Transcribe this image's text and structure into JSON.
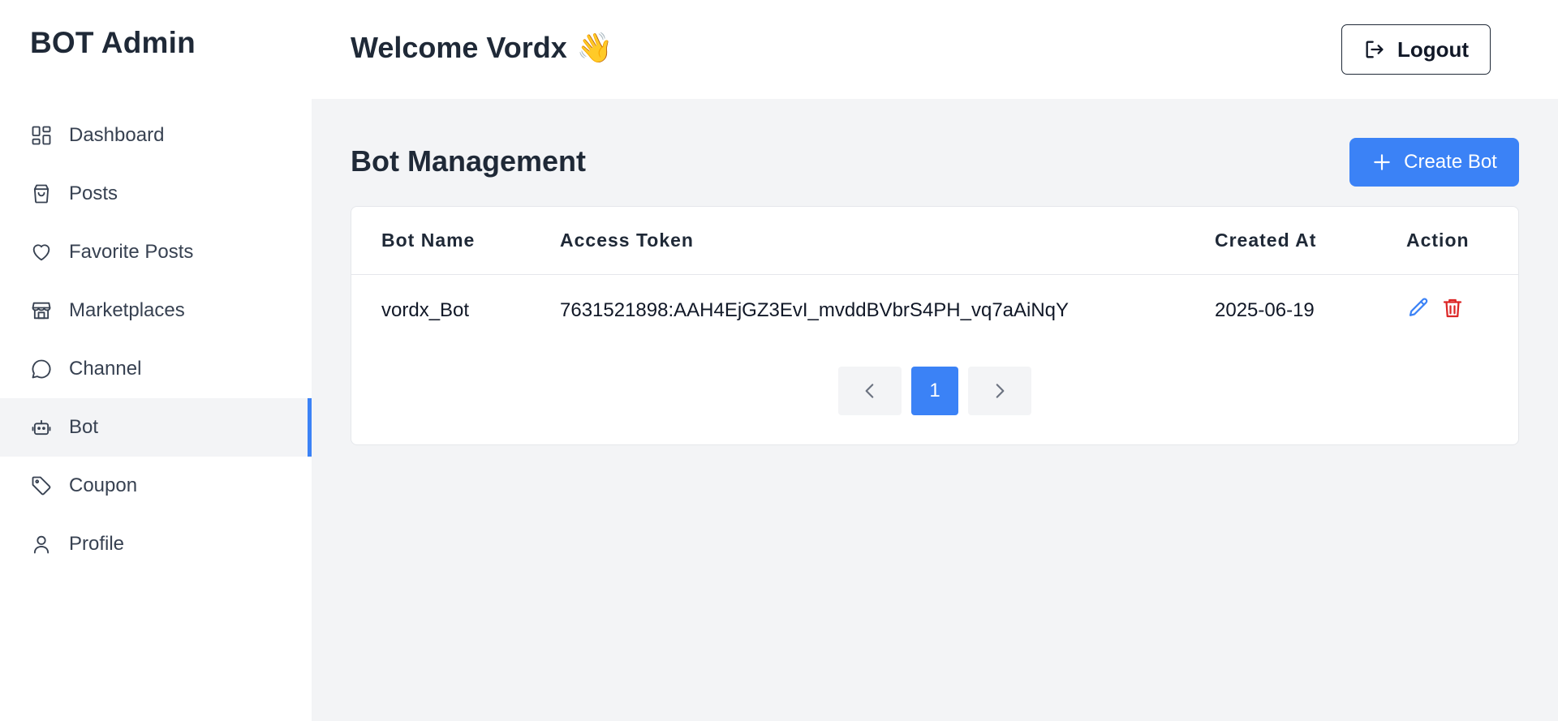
{
  "sidebar": {
    "brand": "BOT Admin",
    "items": [
      {
        "label": "Dashboard",
        "icon": "dashboard-icon"
      },
      {
        "label": "Posts",
        "icon": "shopping-bag-icon"
      },
      {
        "label": "Favorite Posts",
        "icon": "heart-icon"
      },
      {
        "label": "Marketplaces",
        "icon": "store-icon"
      },
      {
        "label": "Channel",
        "icon": "chat-bubble-icon"
      },
      {
        "label": "Bot",
        "icon": "bot-icon",
        "active": true
      },
      {
        "label": "Coupon",
        "icon": "tag-icon"
      },
      {
        "label": "Profile",
        "icon": "user-icon"
      }
    ]
  },
  "header": {
    "welcome": "Welcome Vordx",
    "wave_emoji": "👋",
    "logout_label": "Logout",
    "logout_icon": "logout-icon"
  },
  "main": {
    "title": "Bot Management",
    "create_button_label": "Create Bot",
    "create_button_icon": "plus-icon",
    "table": {
      "columns": [
        "Bot Name",
        "Access Token",
        "Created At",
        "Action"
      ],
      "rows": [
        {
          "bot_name": "vordx_Bot",
          "access_token": "7631521898:AAH4EjGZ3EvI_mvddBVbrS4PH_vq7aAiNqY",
          "created_at": "2025-06-19",
          "actions": [
            "edit-icon",
            "delete-icon"
          ]
        }
      ]
    },
    "pagination": {
      "current_page": "1",
      "prev_icon": "chevron-left-icon",
      "next_icon": "chevron-right-icon"
    }
  },
  "colors": {
    "accent": "#3b82f6",
    "danger": "#dc2626",
    "text": "#1f2937",
    "background": "#f3f4f6"
  }
}
